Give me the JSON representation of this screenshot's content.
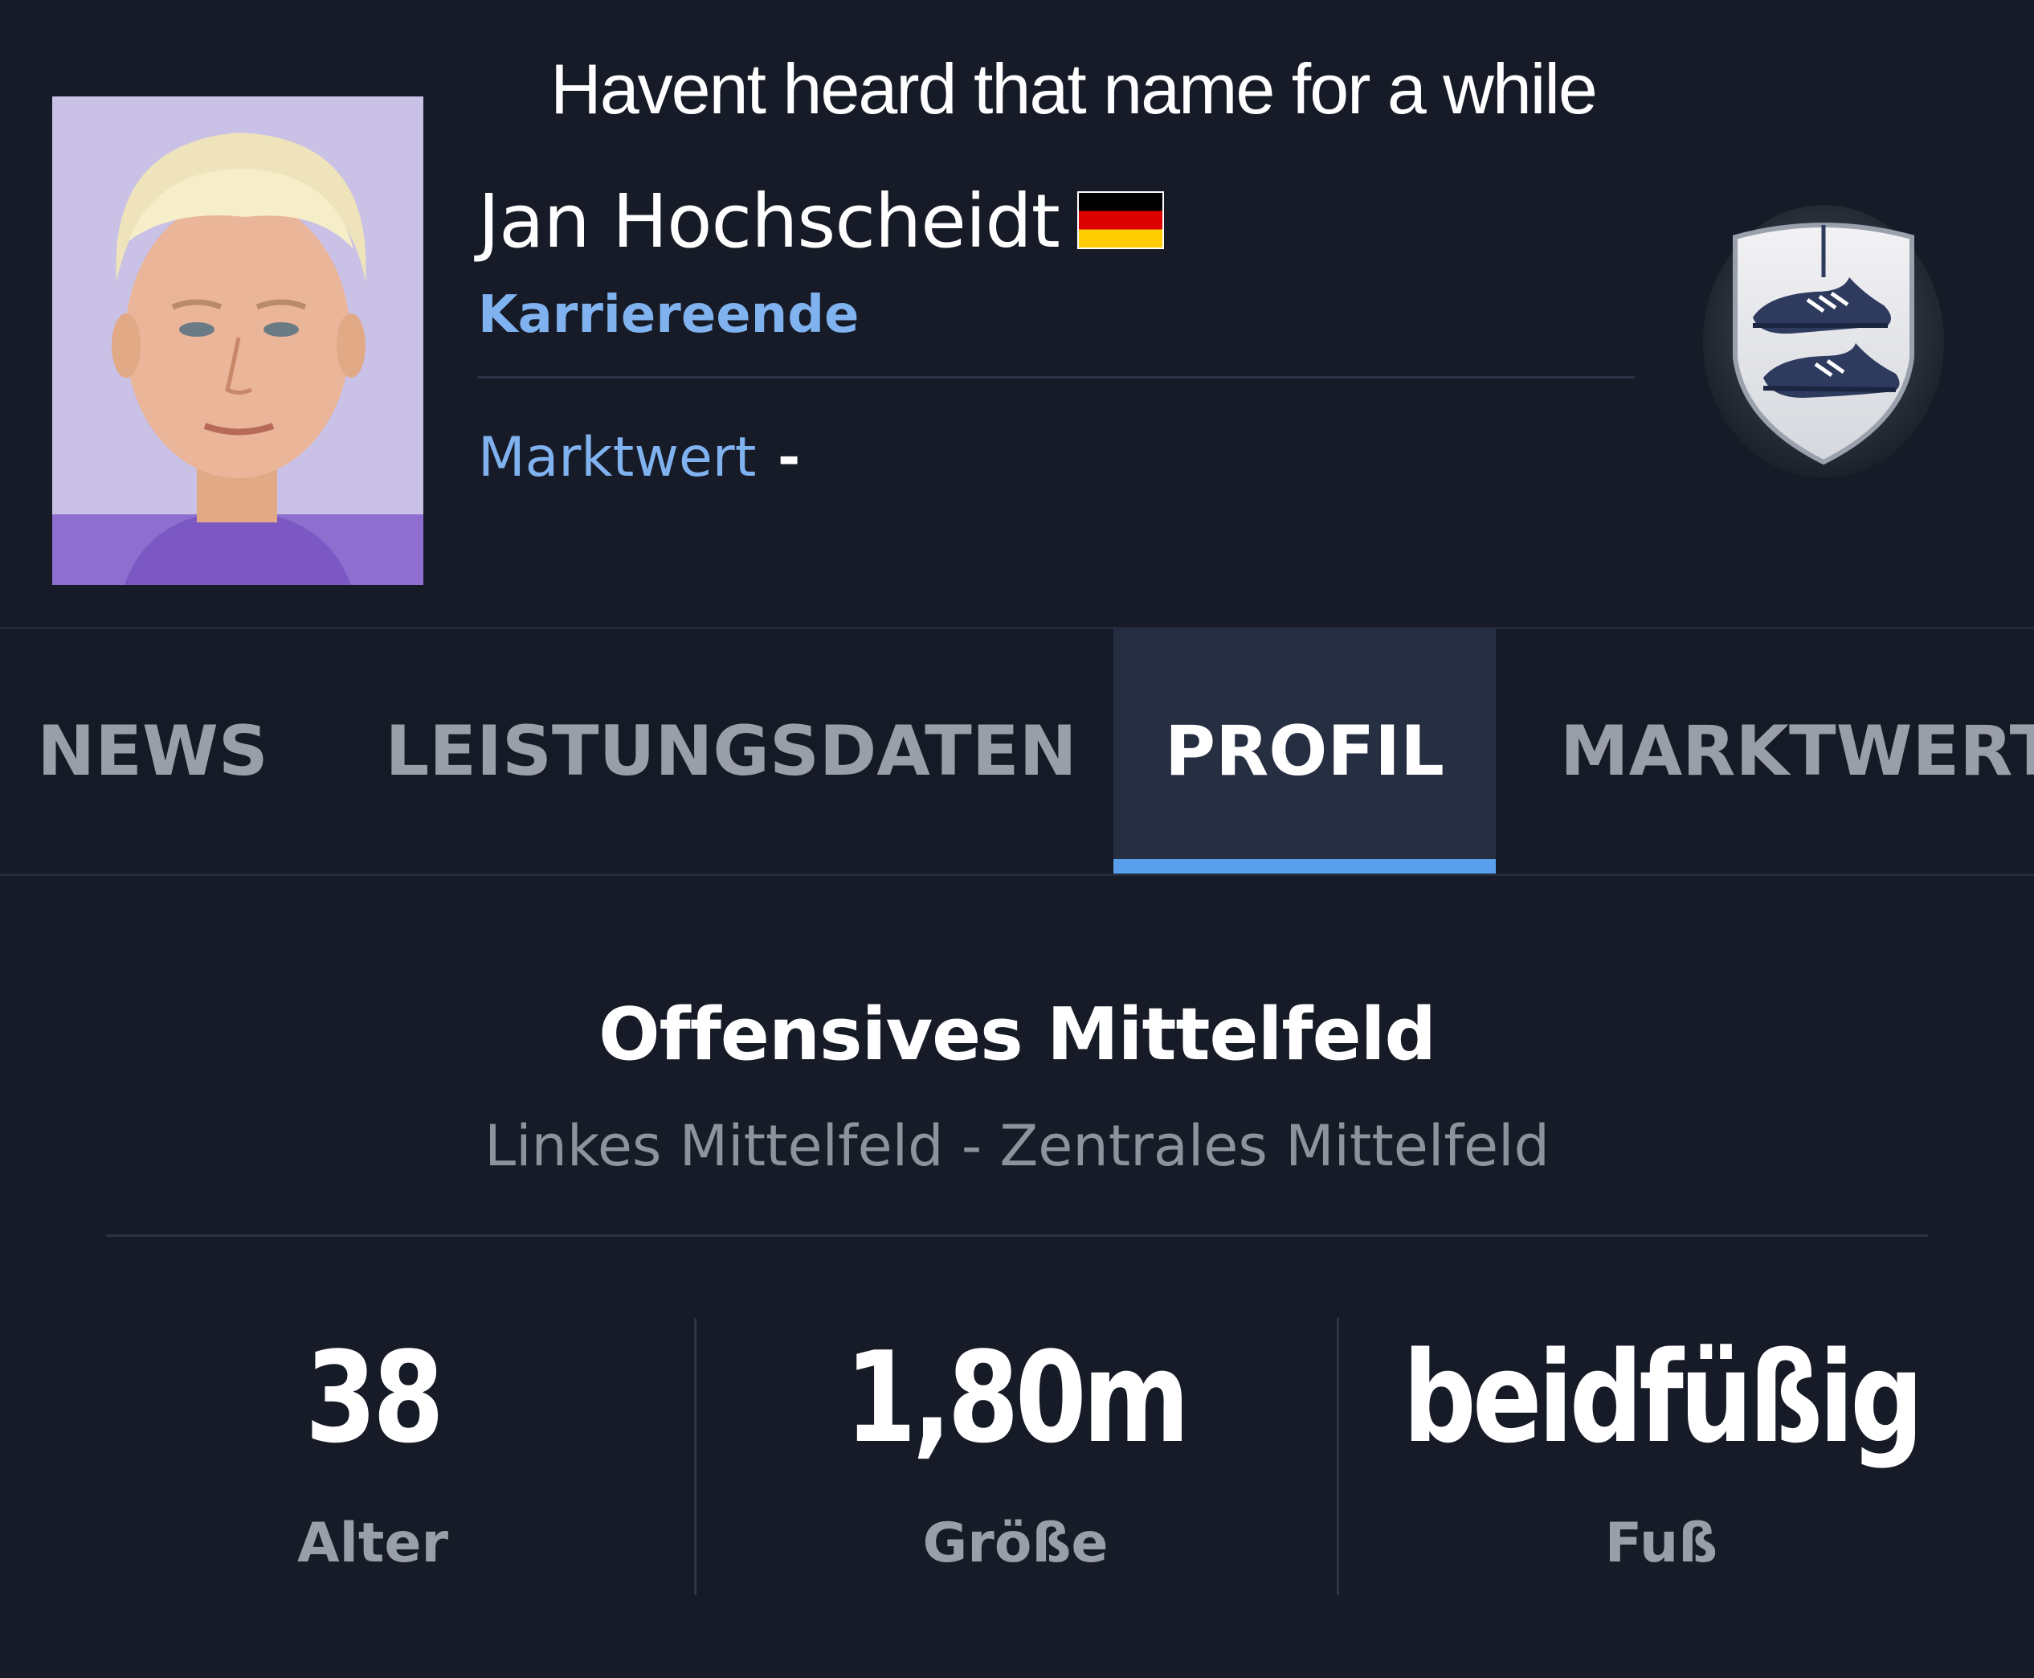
{
  "caption": "Havent heard that name for a while",
  "player": {
    "name": "Jan Hochscheidt",
    "nationality_flag": "germany-flag",
    "status": "Karriereende",
    "market_label": "Marktwert",
    "market_value": "-"
  },
  "tabs": [
    {
      "label": "NEWS",
      "active": false
    },
    {
      "label": "LEISTUNGSDATEN",
      "active": false
    },
    {
      "label": "PROFIL",
      "active": true
    },
    {
      "label": "MARKTWERT",
      "active": false
    }
  ],
  "profile": {
    "main_position": "Offensives Mittelfeld",
    "secondary_positions": "Linkes Mittelfeld - Zentrales Mittelfeld",
    "stats": [
      {
        "value": "38",
        "label": "Alter"
      },
      {
        "value": "1,80m",
        "label": "Größe"
      },
      {
        "value": "beidfüßig",
        "label": "Fuß"
      }
    ]
  },
  "colors": {
    "background": "#161b27",
    "accent_blue": "#7fb2ee",
    "active_tab_bg": "#262f42",
    "active_tab_indicator": "#5a9fec",
    "muted_text": "#9a9ea8"
  },
  "icons": {
    "zoom": "zoom-in-icon",
    "badge": "retired-boots-badge-icon"
  }
}
